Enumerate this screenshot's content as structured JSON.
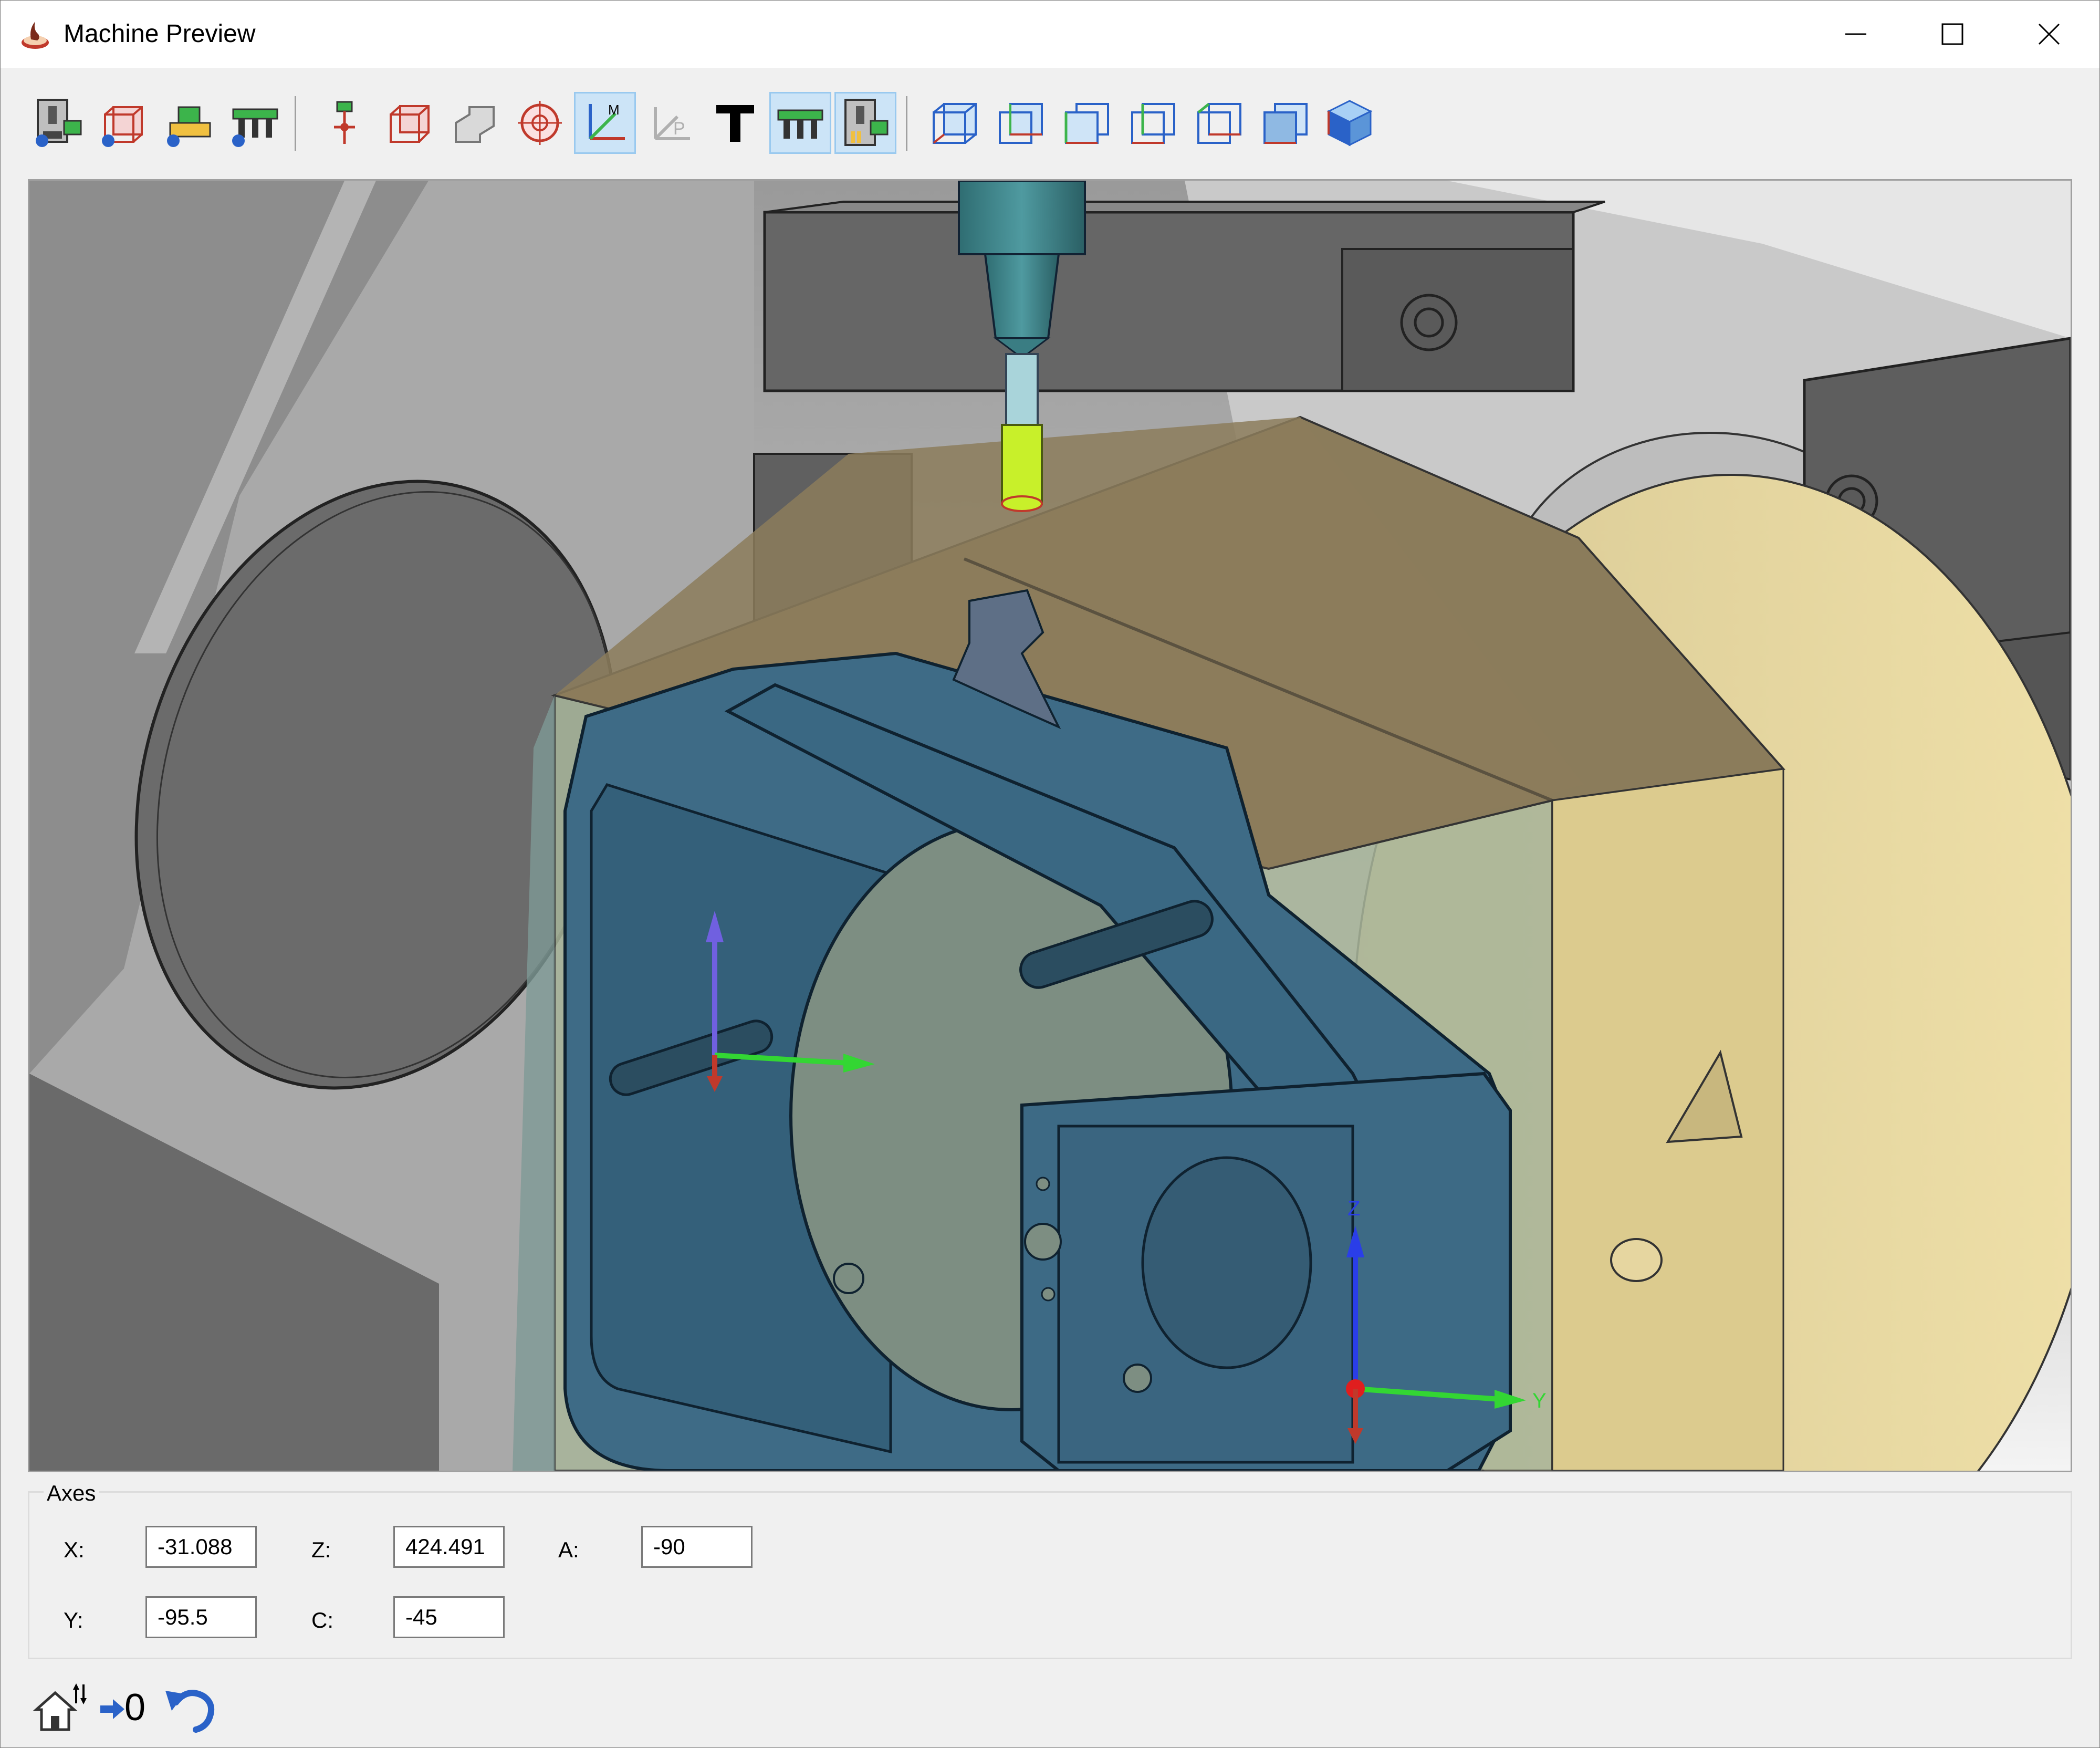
{
  "window": {
    "title": "Machine Preview",
    "controls": [
      "minimize",
      "maximize",
      "close"
    ]
  },
  "toolbar": {
    "buttons": [
      {
        "icon": "machine-setup-icon",
        "active": false
      },
      {
        "icon": "stock-setup-icon",
        "active": false
      },
      {
        "icon": "fixture-setup-icon",
        "active": false
      },
      {
        "icon": "clamps-setup-icon",
        "active": false
      },
      {
        "icon": "tool-icon",
        "active": false
      },
      {
        "icon": "stock-icon",
        "active": false
      },
      {
        "icon": "part-icon",
        "active": false
      },
      {
        "icon": "target-icon",
        "active": false
      },
      {
        "icon": "machine-axes-icon",
        "active": true
      },
      {
        "icon": "part-axes-icon",
        "active": false
      },
      {
        "icon": "text-icon",
        "active": false
      },
      {
        "icon": "clamps-icon",
        "active": true
      },
      {
        "icon": "machine-icon",
        "active": true
      },
      {
        "icon": "view-front-icon",
        "active": false
      },
      {
        "icon": "view-back-icon",
        "active": false
      },
      {
        "icon": "view-left-icon",
        "active": false
      },
      {
        "icon": "view-right-icon",
        "active": false
      },
      {
        "icon": "view-top-icon",
        "active": false
      },
      {
        "icon": "view-bottom-icon",
        "active": false
      },
      {
        "icon": "view-iso-icon",
        "active": false
      }
    ]
  },
  "viewport": {
    "triad_labels": {
      "z": "Z",
      "y": "Y"
    }
  },
  "axes": {
    "legend": "Axes",
    "x_label": "X:",
    "x_value": "-31.088",
    "y_label": "Y:",
    "y_value": "-95.5",
    "z_label": "Z:",
    "z_value": "424.491",
    "c_label": "C:",
    "c_value": "-45",
    "a_label": "A:",
    "a_value": "-90"
  },
  "bottom": {
    "home_icon": "home-axes-icon",
    "zero_label": "0",
    "zero_icon": "arrow-right-icon",
    "undo_icon": "undo-icon"
  },
  "colors": {
    "background": "#f0f0f0",
    "active_button": "#cce4f7",
    "part_blue": "#3d6b85",
    "stock_yellow": "#d9c78e",
    "tool_green": "#ccf230"
  }
}
